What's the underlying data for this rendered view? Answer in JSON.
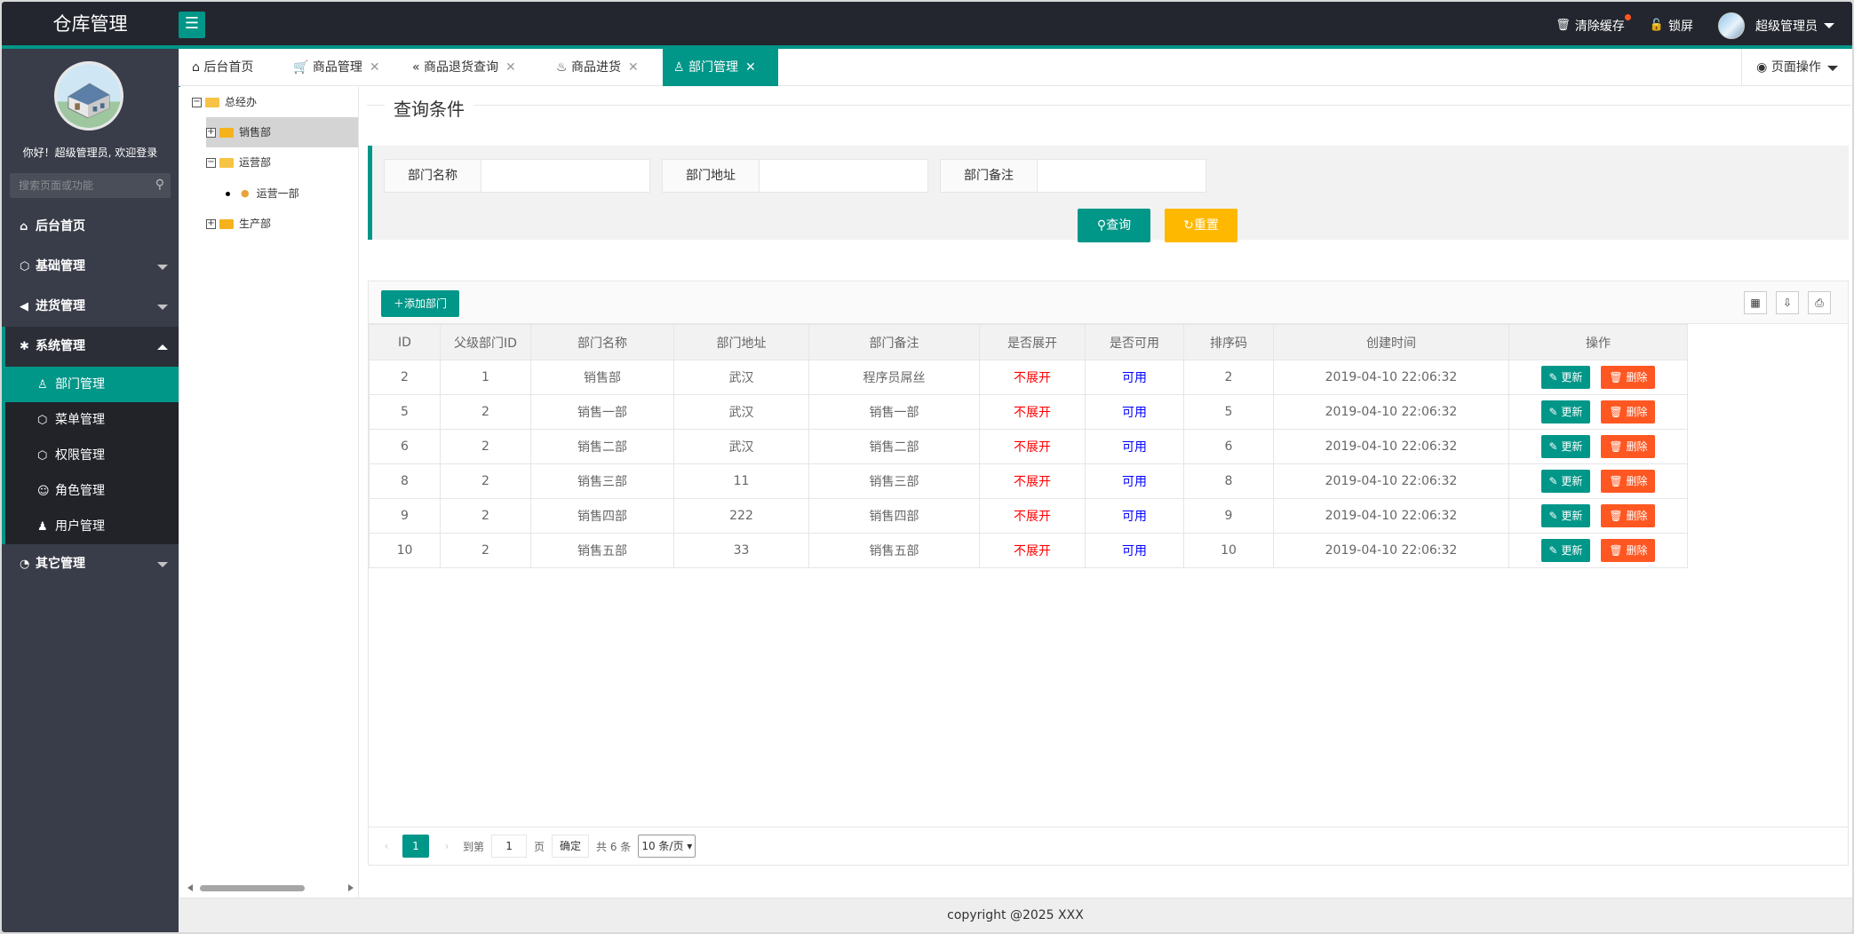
{
  "header": {
    "logo": "仓库管理",
    "menu_toggle": "☰",
    "clear_cache": "清除缓存",
    "lock": "锁屏",
    "user": "超级管理员"
  },
  "sidebar": {
    "welcome": "你好！超级管理员, 欢迎登录",
    "search_placeholder": "搜索页面或功能",
    "items": [
      {
        "label": "后台首页",
        "icon": "home-icon"
      },
      {
        "label": "基础管理",
        "icon": "cube-icon"
      },
      {
        "label": "进货管理",
        "icon": "speaker-icon"
      },
      {
        "label": "系统管理",
        "icon": "gear-icon"
      },
      {
        "label": "其它管理",
        "icon": "settings-icon"
      }
    ],
    "sub_items": [
      {
        "label": "部门管理",
        "icon": "user-icon"
      },
      {
        "label": "菜单管理",
        "icon": "cube-icon"
      },
      {
        "label": "权限管理",
        "icon": "cube-icon"
      },
      {
        "label": "角色管理",
        "icon": "smile-icon"
      },
      {
        "label": "用户管理",
        "icon": "person-icon"
      }
    ]
  },
  "tabs": [
    {
      "label": "后台首页",
      "icon": "home-icon"
    },
    {
      "label": "商品管理",
      "icon": "cart-icon"
    },
    {
      "label": "商品退货查询",
      "icon": "double-left-icon"
    },
    {
      "label": "商品进货",
      "icon": "fire-icon"
    },
    {
      "label": "部门管理",
      "icon": "user-icon"
    }
  ],
  "page_ops": "页面操作",
  "tree": {
    "root": "总经办",
    "nodes": [
      "销售部",
      "运营部",
      "运营一部",
      "生产部"
    ]
  },
  "query": {
    "legend": "查询条件",
    "fields": [
      {
        "label": "部门名称",
        "value": ""
      },
      {
        "label": "部门地址",
        "value": ""
      },
      {
        "label": "部门备注",
        "value": ""
      }
    ],
    "search_btn": "查询",
    "reset_btn": "重置"
  },
  "table": {
    "add_btn": "添加部门",
    "columns": [
      "ID",
      "父级部门ID",
      "部门名称",
      "部门地址",
      "部门备注",
      "是否展开",
      "是否可用",
      "排序码",
      "创建时间",
      "操作"
    ],
    "rows": [
      [
        "2",
        "1",
        "销售部",
        "武汉",
        "程序员屌丝",
        "不展开",
        "可用",
        "2",
        "2019-04-10 22:06:32"
      ],
      [
        "5",
        "2",
        "销售一部",
        "武汉",
        "销售一部",
        "不展开",
        "可用",
        "5",
        "2019-04-10 22:06:32"
      ],
      [
        "6",
        "2",
        "销售二部",
        "武汉",
        "销售二部",
        "不展开",
        "可用",
        "6",
        "2019-04-10 22:06:32"
      ],
      [
        "8",
        "2",
        "销售三部",
        "11",
        "销售三部",
        "不展开",
        "可用",
        "8",
        "2019-04-10 22:06:32"
      ],
      [
        "9",
        "2",
        "销售四部",
        "222",
        "销售四部",
        "不展开",
        "可用",
        "9",
        "2019-04-10 22:06:32"
      ],
      [
        "10",
        "2",
        "销售五部",
        "33",
        "销售五部",
        "不展开",
        "可用",
        "10",
        "2019-04-10 22:06:32"
      ]
    ],
    "update_btn": "更新",
    "delete_btn": "删除"
  },
  "pager": {
    "current": "1",
    "goto_label": "到第",
    "page_input": "1",
    "page_unit": "页",
    "confirm": "确定",
    "total": "共 6 条",
    "page_size": "10 条/页"
  },
  "footer": "copyright @2025 XXX",
  "colors": {
    "accent": "#009688",
    "header_bg": "#23262e",
    "sidebar_bg": "#393d49",
    "danger": "#ff5722",
    "warn": "#ffb800"
  }
}
